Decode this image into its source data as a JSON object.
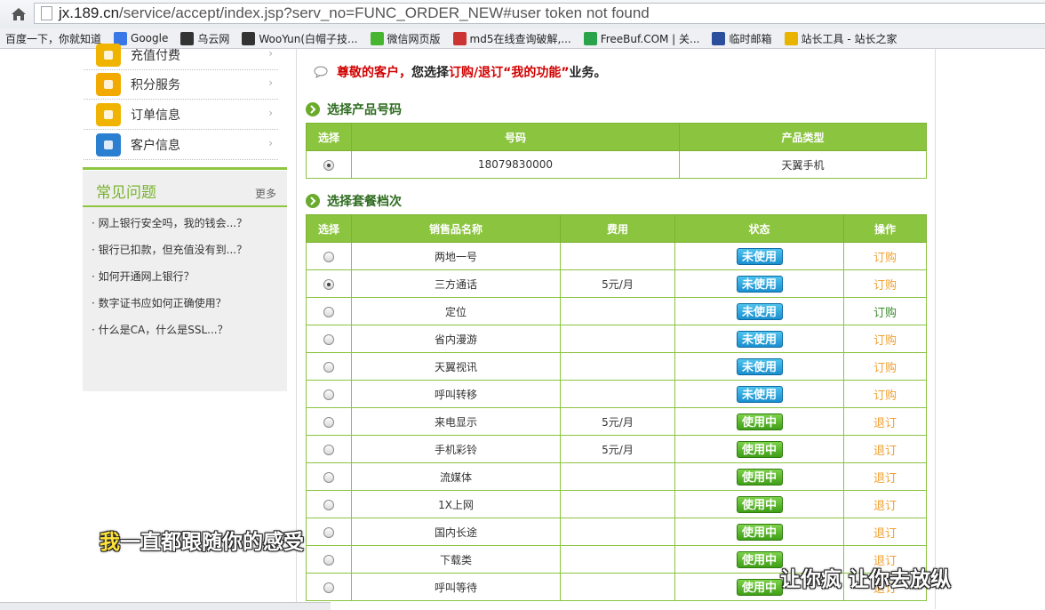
{
  "browser": {
    "url_host": "jx.189.cn",
    "url_rest": "/service/accept/index.jsp?serv_no=FUNC_ORDER_NEW#user token not found",
    "bookmarks": [
      {
        "label": "百度一下，你就知道",
        "icon": "none",
        "color": ""
      },
      {
        "label": "Google",
        "icon": "google-icon",
        "color": "#3b78e7"
      },
      {
        "label": "乌云网",
        "icon": "wooyun-icon",
        "color": "#333333"
      },
      {
        "label": "WooYun(白帽子技...",
        "icon": "wooyun-icon",
        "color": "#333333"
      },
      {
        "label": "微信网页版",
        "icon": "wechat-icon",
        "color": "#48b530"
      },
      {
        "label": "md5在线查询破解,...",
        "icon": "grid-icon",
        "color": "#cc3333"
      },
      {
        "label": "FreeBuf.COM | 关...",
        "icon": "freebuf-icon",
        "color": "#2aa34a"
      },
      {
        "label": "临时邮箱",
        "icon": "mail-icon",
        "color": "#2b4f9c"
      },
      {
        "label": "站长工具 - 站长之家",
        "icon": "tool-icon",
        "color": "#e8b400"
      }
    ]
  },
  "sidebar": {
    "menu": [
      {
        "label": "充值付费",
        "icon": "recharge-icon",
        "color": "#f0b400"
      },
      {
        "label": "积分服务",
        "icon": "star-icon",
        "color": "#f2a900"
      },
      {
        "label": "订单信息",
        "icon": "order-icon",
        "color": "#f0b400"
      },
      {
        "label": "客户信息",
        "icon": "customer-icon",
        "color": "#2a7fd0"
      }
    ],
    "faq": {
      "title": "常见问题",
      "more": "更多",
      "items": [
        "· 网上银行安全吗，我的钱会...？",
        "· 银行已扣款，但充值没有到...？",
        "· 如何开通网上银行？",
        "· 数字证书应如何正确使用？",
        "· 什么是CA，什么是SSL...？"
      ]
    }
  },
  "main": {
    "greeting": {
      "part1": "尊敬的客户，",
      "part2": "您选择",
      "part3": "订购/退订",
      "part4": "“我的功能”",
      "part5": "业务。"
    },
    "section1": {
      "title": "选择产品号码",
      "headers": [
        "选择",
        "号码",
        "产品类型"
      ],
      "rows": [
        {
          "number": "18079830000",
          "type": "天翼手机",
          "checked": true
        }
      ]
    },
    "section2": {
      "title": "选择套餐档次",
      "headers": [
        "选择",
        "销售品名称",
        "费用",
        "状态",
        "操作"
      ],
      "rows": [
        {
          "name": "两地一号",
          "fee": "",
          "status": "未使用",
          "status_type": "unused",
          "action": "订购",
          "checked": false,
          "action_color": "orange"
        },
        {
          "name": "三方通话",
          "fee": "5元/月",
          "status": "未使用",
          "status_type": "unused",
          "action": "订购",
          "checked": true,
          "action_color": "orange"
        },
        {
          "name": "定位",
          "fee": "",
          "status": "未使用",
          "status_type": "unused",
          "action": "订购",
          "checked": false,
          "action_color": "green"
        },
        {
          "name": "省内漫游",
          "fee": "",
          "status": "未使用",
          "status_type": "unused",
          "action": "订购",
          "checked": false,
          "action_color": "orange"
        },
        {
          "name": "天翼视讯",
          "fee": "",
          "status": "未使用",
          "status_type": "unused",
          "action": "订购",
          "checked": false,
          "action_color": "orange"
        },
        {
          "name": "呼叫转移",
          "fee": "",
          "status": "未使用",
          "status_type": "unused",
          "action": "订购",
          "checked": false,
          "action_color": "orange"
        },
        {
          "name": "来电显示",
          "fee": "5元/月",
          "status": "使用中",
          "status_type": "using",
          "action": "退订",
          "checked": false,
          "action_color": "orange"
        },
        {
          "name": "手机彩铃",
          "fee": "5元/月",
          "status": "使用中",
          "status_type": "using",
          "action": "退订",
          "checked": false,
          "action_color": "orange"
        },
        {
          "name": "流媒体",
          "fee": "",
          "status": "使用中",
          "status_type": "using",
          "action": "退订",
          "checked": false,
          "action_color": "orange"
        },
        {
          "name": "1X上网",
          "fee": "",
          "status": "使用中",
          "status_type": "using",
          "action": "退订",
          "checked": false,
          "action_color": "orange"
        },
        {
          "name": "国内长途",
          "fee": "",
          "status": "使用中",
          "status_type": "using",
          "action": "退订",
          "checked": false,
          "action_color": "orange"
        },
        {
          "name": "下载类",
          "fee": "",
          "status": "使用中",
          "status_type": "using",
          "action": "退订",
          "checked": false,
          "action_color": "orange"
        },
        {
          "name": "呼叫等待",
          "fee": "",
          "status": "使用中",
          "status_type": "using",
          "action": "退订",
          "checked": false,
          "action_color": "orange"
        }
      ]
    }
  },
  "overlay": {
    "subtitle_left": {
      "first_char": "我",
      "rest": "一直都跟随你的感受"
    },
    "subtitle_right": "让你疯 让你去放纵"
  }
}
